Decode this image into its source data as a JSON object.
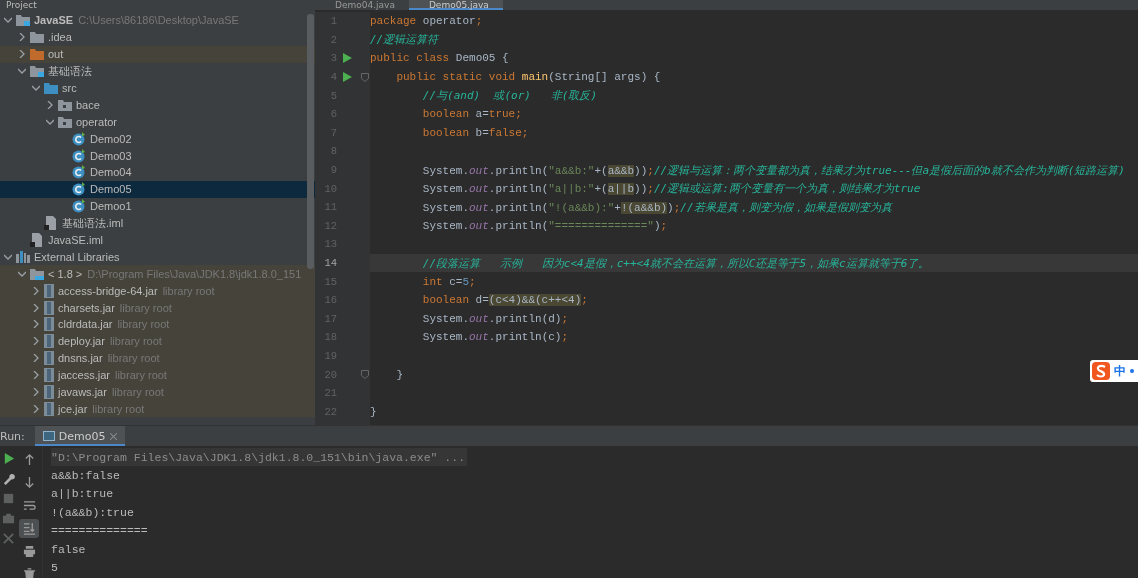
{
  "project_panel": {
    "title": "Project",
    "tree": [
      {
        "label": "JavaSE",
        "secondary": "C:\\Users\\86186\\Desktop\\JavaSE",
        "kind": "module",
        "bold": true,
        "expanded": true,
        "selected": false,
        "children": [
          {
            "label": ".idea",
            "kind": "folder",
            "expanded": false,
            "selected": false
          },
          {
            "label": "out",
            "kind": "excluded",
            "expanded": false,
            "selected": false
          },
          {
            "label": "基础语法",
            "kind": "module",
            "expanded": true,
            "selected": false,
            "children": [
              {
                "label": "src",
                "kind": "source",
                "expanded": true,
                "selected": false,
                "children": [
                  {
                    "label": "bace",
                    "kind": "package",
                    "expanded": false,
                    "selected": false
                  },
                  {
                    "label": "operator",
                    "kind": "package",
                    "expanded": true,
                    "selected": false,
                    "children": [
                      {
                        "label": "Demo02",
                        "kind": "class",
                        "selected": false
                      },
                      {
                        "label": "Demo03",
                        "kind": "class",
                        "selected": false
                      },
                      {
                        "label": "Demo04",
                        "kind": "class",
                        "selected": false
                      },
                      {
                        "label": "Demo05",
                        "kind": "class",
                        "selected": true
                      },
                      {
                        "label": "Demoo1",
                        "kind": "class",
                        "selected": false
                      }
                    ]
                  }
                ]
              },
              {
                "label": "基础语法.iml",
                "kind": "iml",
                "selected": false
              }
            ]
          },
          {
            "label": "JavaSE.iml",
            "kind": "iml",
            "selected": false
          }
        ]
      },
      {
        "label": "External Libraries",
        "kind": "libraries",
        "expanded": true,
        "selected": false,
        "children": [
          {
            "label": "< 1.8 >",
            "secondary": "D:\\Program Files\\Java\\JDK1.8\\jdk1.8.0_151",
            "kind": "jdk",
            "expanded": true,
            "selected": false,
            "children": [
              {
                "label": "access-bridge-64.jar",
                "secondary": "library root",
                "kind": "jar",
                "expanded": false,
                "selected": false
              },
              {
                "label": "charsets.jar",
                "secondary": "library root",
                "kind": "jar",
                "expanded": false,
                "selected": false
              },
              {
                "label": "cldrdata.jar",
                "secondary": "library root",
                "kind": "jar",
                "expanded": false,
                "selected": false
              },
              {
                "label": "deploy.jar",
                "secondary": "library root",
                "kind": "jar",
                "expanded": false,
                "selected": false
              },
              {
                "label": "dnsns.jar",
                "secondary": "library root",
                "kind": "jar",
                "expanded": false,
                "selected": false
              },
              {
                "label": "jaccess.jar",
                "secondary": "library root",
                "kind": "jar",
                "expanded": false,
                "selected": false
              },
              {
                "label": "javaws.jar",
                "secondary": "library root",
                "kind": "jar",
                "expanded": false,
                "selected": false
              },
              {
                "label": "jce.jar",
                "secondary": "library root",
                "kind": "jar",
                "expanded": false,
                "selected": false
              }
            ]
          }
        ]
      }
    ]
  },
  "editor": {
    "tabs": [
      {
        "label": "Demo04.java",
        "selected": false
      },
      {
        "label": "Demo05.java",
        "selected": true
      }
    ],
    "lines": [
      {
        "n": "1",
        "current": false,
        "tokens": [
          {
            "keyword": "package "
          },
          {
            "text": "operator"
          },
          {
            "keyword": ";"
          }
        ]
      },
      {
        "n": "2",
        "current": false,
        "tokens": [
          {
            "comment": "//逻辑运算符"
          }
        ]
      },
      {
        "n": "3",
        "current": false,
        "run": true,
        "tokens": [
          {
            "keyword": "public class "
          },
          {
            "text": "Demo05 {"
          }
        ]
      },
      {
        "n": "4",
        "current": false,
        "kind": "member",
        "run": true,
        "fold": true,
        "tokens": [
          {
            "keyword": "public static void "
          },
          {
            "method": "main"
          },
          {
            "text": "(String[] args) {"
          }
        ]
      },
      {
        "n": "5",
        "current": false,
        "kind": "statement",
        "tokens": [
          {
            "comment": "//与(and)  或(or)   非(取反)"
          }
        ]
      },
      {
        "n": "6",
        "current": false,
        "kind": "statement",
        "tokens": [
          {
            "keyword": "boolean "
          },
          {
            "text": "a="
          },
          {
            "keyword": "true;"
          }
        ]
      },
      {
        "n": "7",
        "current": false,
        "kind": "statement",
        "tokens": [
          {
            "keyword": "boolean "
          },
          {
            "text": "b="
          },
          {
            "keyword": "false;"
          }
        ]
      },
      {
        "n": "8",
        "current": false
      },
      {
        "n": "9",
        "current": false,
        "kind": "statement",
        "tokens": [
          {
            "text": "System."
          },
          {
            "field": "out"
          },
          {
            "text": ".println("
          },
          {
            "string": "\"a&&b:\""
          },
          {
            "text": "+("
          },
          {
            "match": "a&&b"
          },
          {
            "text": "))"
          },
          {
            "keyword": ";"
          },
          {
            "comment": "//逻辑与运算：两个变量都为真，结果才为true---但a是假后面的b就不会作为判断(短路运算)"
          }
        ]
      },
      {
        "n": "10",
        "current": false,
        "kind": "statement",
        "tokens": [
          {
            "text": "System."
          },
          {
            "field": "out"
          },
          {
            "text": ".println("
          },
          {
            "string": "\"a||b:\""
          },
          {
            "text": "+("
          },
          {
            "match": "a||b"
          },
          {
            "text": "))"
          },
          {
            "keyword": ";"
          },
          {
            "comment": "//逻辑或运算:两个变量有一个为真，则结果才为true"
          }
        ]
      },
      {
        "n": "11",
        "current": false,
        "kind": "statement",
        "tokens": [
          {
            "text": "System."
          },
          {
            "field": "out"
          },
          {
            "text": ".println("
          },
          {
            "string": "\"!(a&&b):\""
          },
          {
            "text": "+"
          },
          {
            "match": "!(a&&b)"
          },
          {
            "text": ")"
          },
          {
            "keyword": ";"
          },
          {
            "comment": "//若果是真，则变为假，如果是假则变为真"
          }
        ]
      },
      {
        "n": "12",
        "current": false,
        "kind": "statement",
        "tokens": [
          {
            "text": "System."
          },
          {
            "field": "out"
          },
          {
            "text": ".println("
          },
          {
            "string": "\"==============\""
          },
          {
            "text": ")"
          },
          {
            "keyword": ";"
          }
        ]
      },
      {
        "n": "13",
        "current": false
      },
      {
        "n": "14",
        "current": true,
        "kind": "statement",
        "tokens": [
          {
            "comment": "//段落运算   示例   因为c<4是假，c++<4就不会在运算，所以C还是等于5，如果c运算就等于6了。"
          }
        ]
      },
      {
        "n": "15",
        "current": false,
        "kind": "statement",
        "tokens": [
          {
            "keyword": "int "
          },
          {
            "text": "c="
          },
          {
            "number": "5"
          },
          {
            "keyword": ";"
          }
        ]
      },
      {
        "n": "16",
        "current": false,
        "kind": "statement",
        "tokens": [
          {
            "keyword": "boolean "
          },
          {
            "text": "d="
          },
          {
            "match": "(c<4)&&(c++<4)"
          },
          {
            "keyword": ";"
          }
        ]
      },
      {
        "n": "17",
        "current": false,
        "kind": "statement",
        "tokens": [
          {
            "text": "System."
          },
          {
            "field": "out"
          },
          {
            "text": ".println(d)"
          },
          {
            "keyword": ";"
          }
        ]
      },
      {
        "n": "18",
        "current": false,
        "kind": "statement",
        "tokens": [
          {
            "text": "System."
          },
          {
            "field": "out"
          },
          {
            "text": ".println(c)"
          },
          {
            "keyword": ";"
          }
        ]
      },
      {
        "n": "19",
        "current": false
      },
      {
        "n": "20",
        "current": false,
        "kind": "member",
        "fold": true,
        "tokens": [
          {
            "text": "}"
          }
        ]
      },
      {
        "n": "21",
        "current": false
      },
      {
        "n": "22",
        "current": false,
        "tokens": [
          {
            "text": "}"
          }
        ]
      }
    ]
  },
  "ime_widget": {
    "label": "中"
  },
  "run_panel": {
    "label": "Run:",
    "tab": "Demo05",
    "left_tools": [
      {
        "kind": "play",
        "disabled": false
      },
      {
        "kind": "wrench",
        "disabled": false
      },
      {
        "kind": "stop",
        "disabled": true
      },
      {
        "kind": "camera",
        "disabled": true
      },
      {
        "kind": "close",
        "disabled": true
      }
    ],
    "right_tools": [
      {
        "kind": "up",
        "selected": false
      },
      {
        "kind": "down",
        "selected": false
      },
      {
        "kind": "wrap",
        "selected": false
      },
      {
        "kind": "scroll-end",
        "selected": true
      },
      {
        "kind": "print",
        "selected": false
      },
      {
        "kind": "trash",
        "selected": false
      }
    ],
    "output": [
      {
        "kind": "command",
        "text": "\"D:\\Program Files\\Java\\JDK1.8\\jdk1.8.0_151\\bin\\java.exe\" ..."
      },
      {
        "kind": "out",
        "text": "a&&b:false"
      },
      {
        "kind": "out",
        "text": "a||b:true"
      },
      {
        "kind": "out",
        "text": "!(a&&b):true"
      },
      {
        "kind": "out",
        "text": "=============="
      },
      {
        "kind": "out",
        "text": "false"
      },
      {
        "kind": "out",
        "text": "5"
      }
    ]
  }
}
